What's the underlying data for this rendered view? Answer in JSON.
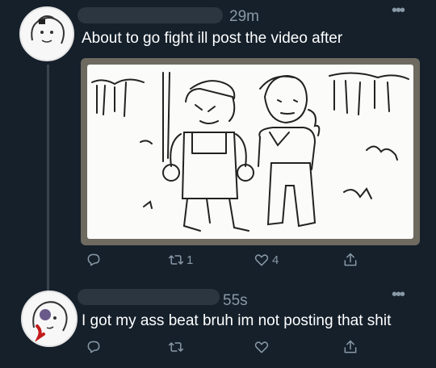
{
  "tweets": [
    {
      "timestamp": "29m",
      "text": "About to go fight ill post the video after",
      "media_icon": "sketch-image",
      "actions": {
        "reply_count": "",
        "retweet_count": "1",
        "like_count": "4"
      }
    },
    {
      "timestamp": "55s",
      "text": "I got my ass beat bruh im not posting that shit",
      "actions": {
        "reply_count": "",
        "retweet_count": "",
        "like_count": ""
      }
    }
  ],
  "colors": {
    "background": "#15202b",
    "muted": "#8899a6",
    "thread_line": "#38444d",
    "text": "#ffffff"
  },
  "icons": [
    "reply-icon",
    "retweet-icon",
    "like-icon",
    "share-icon",
    "more-icon"
  ]
}
